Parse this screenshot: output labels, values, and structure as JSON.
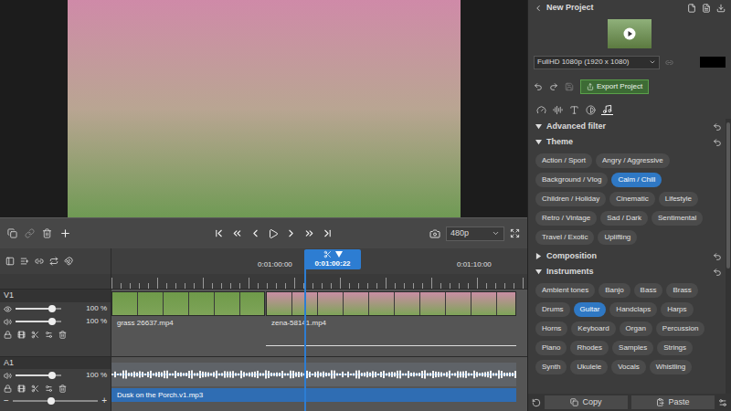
{
  "project": {
    "title": "New Project",
    "resolution": "FullHD 1080p (1920 x 1080)",
    "export_button": "Export Project"
  },
  "preview_quality": "480p",
  "timeline": {
    "ruler": [
      "0:01:00:00",
      "0:01:10:00"
    ],
    "playhead": "0:01:00:22",
    "tracks": [
      {
        "name": "V1",
        "kind": "video",
        "sliders": [
          {
            "kind": "opacity",
            "level": 0.8,
            "reading": "100 %"
          },
          {
            "kind": "volume",
            "level": 0.8,
            "reading": "100 %"
          }
        ],
        "clips": [
          {
            "name": "grass 26637.mp4",
            "color": "#6f9a4a"
          },
          {
            "name": "zena-58141.mp4",
            "color": "#c98ea4"
          }
        ]
      },
      {
        "name": "A1",
        "kind": "audio",
        "sliders": [
          {
            "kind": "volume",
            "level": 0.8,
            "reading": "100 %"
          }
        ],
        "clips": [
          {
            "name": "Dusk on the Porch.v1.mp3",
            "color": "#2f6db3"
          }
        ]
      }
    ],
    "zoom": {
      "minus": "−",
      "plus": "+",
      "level": 0.45
    }
  },
  "panel_tabs": [
    {
      "kind": "speed",
      "selected": false
    },
    {
      "kind": "audio",
      "selected": false
    },
    {
      "kind": "text",
      "selected": false
    },
    {
      "kind": "overlay",
      "selected": false
    },
    {
      "kind": "music",
      "selected": true
    }
  ],
  "filter_sections": [
    {
      "label": "Advanced filter",
      "expanded": true,
      "chips": []
    },
    {
      "label": "Theme",
      "expanded": true,
      "chips": [
        {
          "label": "Action / Sport",
          "selected": false
        },
        {
          "label": "Angry / Aggressive",
          "selected": false
        },
        {
          "label": "Background / Vlog",
          "selected": false
        },
        {
          "label": "Calm / Chill",
          "selected": true
        },
        {
          "label": "Children / Holiday",
          "selected": false
        },
        {
          "label": "Cinematic",
          "selected": false
        },
        {
          "label": "Lifestyle",
          "selected": false
        },
        {
          "label": "Retro / Vintage",
          "selected": false
        },
        {
          "label": "Sad / Dark",
          "selected": false
        },
        {
          "label": "Sentimental",
          "selected": false
        },
        {
          "label": "Travel / Exotic",
          "selected": false
        },
        {
          "label": "Uplifting",
          "selected": false
        }
      ]
    },
    {
      "label": "Composition",
      "expanded": false,
      "chips": []
    },
    {
      "label": "Instruments",
      "expanded": true,
      "chips": [
        {
          "label": "Ambient tones",
          "selected": false
        },
        {
          "label": "Banjo",
          "selected": false
        },
        {
          "label": "Bass",
          "selected": false
        },
        {
          "label": "Brass",
          "selected": false
        },
        {
          "label": "Drums",
          "selected": false
        },
        {
          "label": "Guitar",
          "selected": true
        },
        {
          "label": "Handclaps",
          "selected": false
        },
        {
          "label": "Harps",
          "selected": false
        },
        {
          "label": "Horns",
          "selected": false
        },
        {
          "label": "Keyboard",
          "selected": false
        },
        {
          "label": "Organ",
          "selected": false
        },
        {
          "label": "Percussion",
          "selected": false
        },
        {
          "label": "Piano",
          "selected": false
        },
        {
          "label": "Rhodes",
          "selected": false
        },
        {
          "label": "Samples",
          "selected": false
        },
        {
          "label": "Strings",
          "selected": false
        },
        {
          "label": "Synth",
          "selected": false
        },
        {
          "label": "Ukulele",
          "selected": false
        },
        {
          "label": "Vocals",
          "selected": false
        },
        {
          "label": "Whistling",
          "selected": false
        }
      ]
    }
  ],
  "footer_buttons": [
    {
      "label": "Copy",
      "kind": "copy"
    },
    {
      "label": "Paste",
      "kind": "paste"
    }
  ]
}
